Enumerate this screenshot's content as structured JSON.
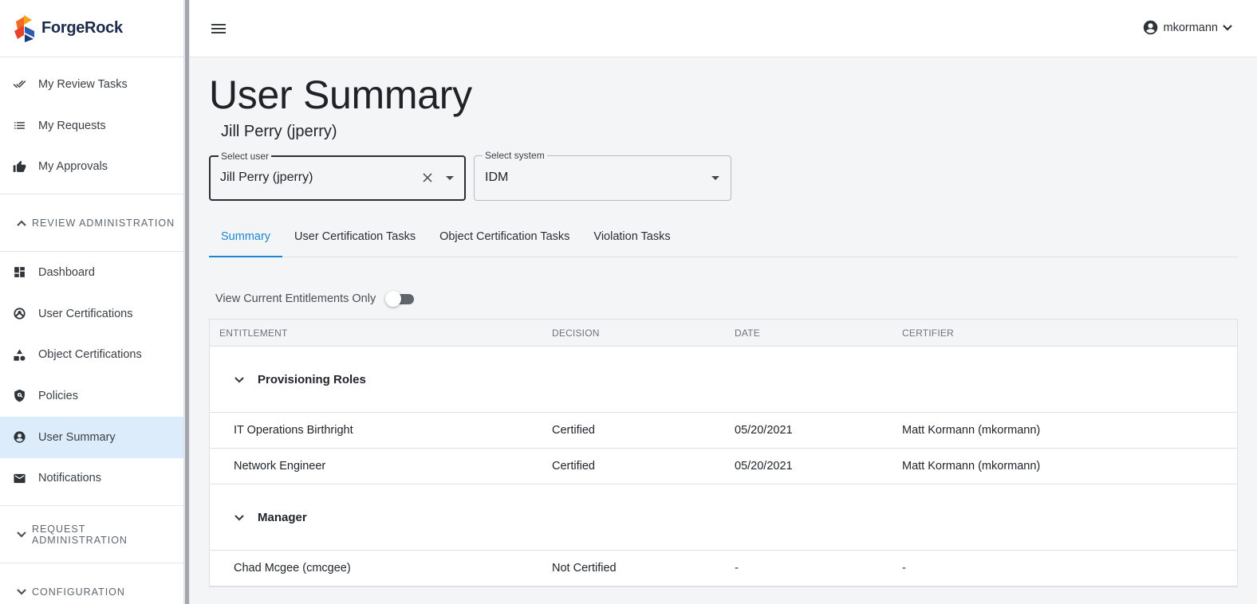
{
  "brand": {
    "name": "ForgeRock"
  },
  "sidebar": {
    "top_items": [
      {
        "label": "My Review Tasks",
        "icon": "double-check-icon"
      },
      {
        "label": "My Requests",
        "icon": "list-icon"
      },
      {
        "label": "My Approvals",
        "icon": "thumb-up-icon"
      }
    ],
    "review_admin": {
      "header": "REVIEW ADMINISTRATION",
      "items": [
        {
          "label": "Dashboard",
          "icon": "dashboard-icon"
        },
        {
          "label": "User Certifications",
          "icon": "user-cert-icon"
        },
        {
          "label": "Object Certifications",
          "icon": "shapes-icon"
        },
        {
          "label": "Policies",
          "icon": "shield-icon"
        },
        {
          "label": "User Summary",
          "icon": "account-circle-icon",
          "active": true
        },
        {
          "label": "Notifications",
          "icon": "mail-icon"
        }
      ]
    },
    "request_admin": {
      "header": "REQUEST ADMINISTRATION"
    },
    "configuration": {
      "header": "CONFIGURATION"
    }
  },
  "topbar": {
    "username": "mkormann"
  },
  "main": {
    "title": "User Summary",
    "subtitle": "Jill Perry (jperry)",
    "select_user": {
      "label": "Select user",
      "value": "Jill Perry (jperry)"
    },
    "select_system": {
      "label": "Select system",
      "value": "IDM"
    },
    "tabs": [
      "Summary",
      "User Certification Tasks",
      "Object Certification Tasks",
      "Violation Tasks"
    ],
    "toggle_label": "View Current Entitlements Only",
    "toggle_on": false,
    "table": {
      "headers": [
        "ENTITLEMENT",
        "DECISION",
        "DATE",
        "CERTIFIER"
      ],
      "groups": [
        {
          "name": "Provisioning Roles",
          "rows": [
            [
              "IT Operations Birthright",
              "Certified",
              "05/20/2021",
              "Matt Kormann (mkormann)"
            ],
            [
              "Network Engineer",
              "Certified",
              "05/20/2021",
              "Matt Kormann (mkormann)"
            ]
          ]
        },
        {
          "name": "Manager",
          "rows": [
            [
              "Chad Mcgee (cmcgee)",
              "Not Certified",
              "-",
              "-"
            ]
          ]
        }
      ]
    }
  },
  "colors": {
    "accent": "#1c86d6",
    "active_nav_bg": "#dcecfa",
    "brand_orange": "#f26b21"
  }
}
